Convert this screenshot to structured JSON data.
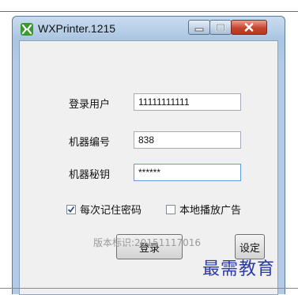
{
  "window": {
    "title": "WXPrinter.1215",
    "icon": "wx-logo-icon",
    "controls": [
      "minimize-icon",
      "maximize-icon",
      "close-icon"
    ]
  },
  "form": {
    "username_label": "登录用户",
    "username_value": "11111111111",
    "machine_no_label": "机器编号",
    "machine_no_value": "838",
    "machine_key_label": "机器秘钥",
    "machine_key_value": "******"
  },
  "options": {
    "remember_password_label": "每次记住密码",
    "remember_password_checked": true,
    "local_ads_label": "本地播放广告",
    "local_ads_checked": false
  },
  "buttons": {
    "login_label": "登录",
    "settings_label": "设定"
  },
  "footer": {
    "version_text": "版本标识:20151117016"
  },
  "watermark": {
    "text": "最需教育"
  },
  "colors": {
    "titlebar": "#b2cbe6",
    "close_button": "#c7452e",
    "watermark": "#2a3aa5",
    "input_focus_border": "#569de5"
  }
}
